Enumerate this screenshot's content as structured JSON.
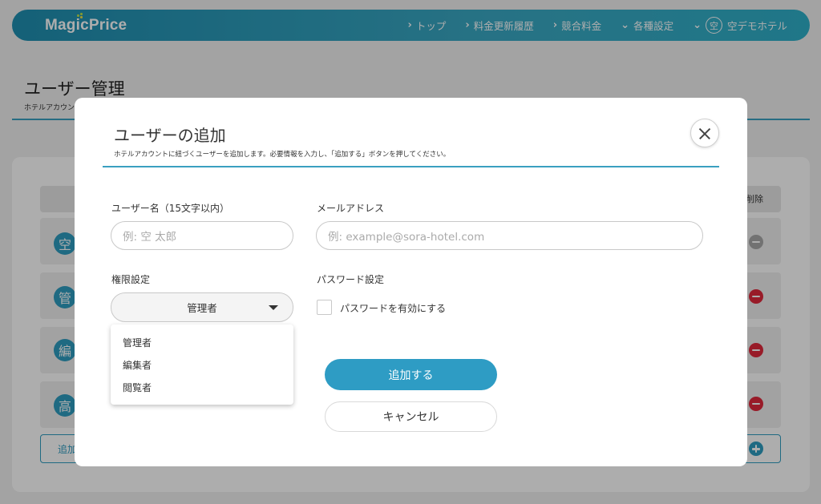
{
  "navbar": {
    "logo": "MagicPrice",
    "items": [
      {
        "label": "トップ",
        "chevron": "›"
      },
      {
        "label": "料金更新履歴",
        "chevron": "›"
      },
      {
        "label": "競合料金",
        "chevron": "›"
      },
      {
        "label": "各種設定",
        "chevron": "⌄"
      }
    ],
    "hotel": {
      "badge": "空",
      "label": "空デモホテル",
      "chevron": "⌄"
    }
  },
  "page": {
    "title": "ユーザー管理",
    "subtitle": "ホテルアカウン",
    "table_header_delete": "削除",
    "rows": [
      {
        "avatar": "空",
        "delete_enabled": false
      },
      {
        "avatar": "管",
        "delete_enabled": true
      },
      {
        "avatar": "編",
        "delete_enabled": true
      },
      {
        "avatar": "高",
        "delete_enabled": true
      }
    ],
    "add_row_label": "追加"
  },
  "modal": {
    "title": "ユーザーの追加",
    "description": "ホテルアカウントに紐づくユーザーを追加します。必要情報を入力し、「追加する」ボタンを押してください。",
    "username": {
      "label": "ユーザー名（15文字以内）",
      "placeholder": "例: 空 太郎",
      "value": ""
    },
    "email": {
      "label": "メールアドレス",
      "placeholder": "例: example@sora-hotel.com",
      "value": ""
    },
    "role": {
      "label": "権限設定",
      "selected": "管理者",
      "options": [
        "管理者",
        "編集者",
        "閲覧者"
      ]
    },
    "password": {
      "label": "パスワード設定",
      "checkbox_label": "パスワードを有効にする",
      "checked": false
    },
    "submit_label": "追加する",
    "cancel_label": "キャンセル"
  },
  "colors": {
    "accent": "#2e9cc4",
    "danger": "#e0283c",
    "disabled": "#a8a8a8"
  }
}
